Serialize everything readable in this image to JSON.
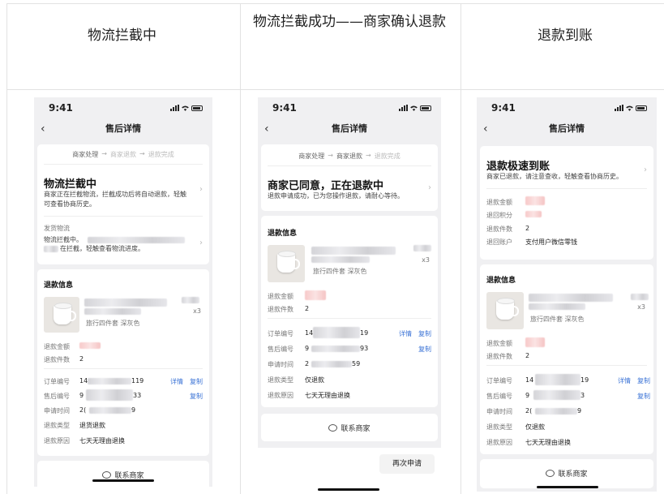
{
  "columns": [
    {
      "header": "物流拦截中"
    },
    {
      "header": "物流拦截成功——商家确认退款"
    },
    {
      "header": "退款到账"
    }
  ],
  "phone": {
    "time": "9:41",
    "title": "售后详情",
    "back_glyph": "‹",
    "chevron_glyph": "›"
  },
  "steps": {
    "s1": "商家处理",
    "s2": "商家退款",
    "s3": "退款完成",
    "arrow": "→"
  },
  "p1": {
    "status_title": "物流拦截中",
    "status_desc": "商家正在拦截物流，拦截成功后将自动退款，轻触可查看协商历史。",
    "logistics_label": "发货物流",
    "logistics_line1": "物流拦截中。",
    "logistics_line2": "在拦截，轻触查看物流进度。",
    "info_title": "退款信息",
    "spec": "旅行四件套 深灰色",
    "qty": "x3",
    "rows": {
      "amount": "退款金额",
      "count": "退款件数",
      "count_val": "2",
      "order": "订单编号",
      "order_a": "14",
      "order_b": "119",
      "after": "售后编号",
      "after_a": "9",
      "after_b": "33",
      "apply": "申请时间",
      "apply_a": "2(",
      "apply_b": "9",
      "type": "退款类型",
      "type_val": "退货退款",
      "reason": "退款原因",
      "reason_val": "七天无理由退换",
      "detail": "详情",
      "copy": "复制"
    },
    "contact": "联系商家"
  },
  "p2": {
    "status_title": "商家已同意，正在退款中",
    "status_desc": "退款申请成功，已为您操作退款，请耐心等待。",
    "info_title": "退款信息",
    "spec": "旅行四件套 深灰色",
    "qty": "x3",
    "rows": {
      "amount": "退款金额",
      "count": "退款件数",
      "count_val": "2",
      "order": "订单编号",
      "order_a": "14",
      "order_b": "19",
      "after": "售后编号",
      "after_a": "9",
      "after_b": "93",
      "apply": "申请时间",
      "apply_a": "2",
      "apply_b": "59",
      "type": "退款类型",
      "type_val": "仅退款",
      "reason": "退款原因",
      "reason_val": "七天无理由退换",
      "detail": "详情",
      "copy": "复制"
    },
    "contact": "联系商家",
    "reapply": "再次申请"
  },
  "p3": {
    "status_title": "退款极速到账",
    "status_desc": "商家已退款，请注意查收，轻触查看协商历史。",
    "top_rows": {
      "amount": "退款金额",
      "points": "退回积分",
      "count": "退款件数",
      "count_val": "2",
      "account": "退回账户",
      "account_val": "支付用户微信零钱"
    },
    "info_title": "退款信息",
    "spec": "旅行四件套 深灰色",
    "qty": "x3",
    "rows": {
      "amount": "退款金额",
      "count": "退款件数",
      "count_val": "2",
      "order": "订单编号",
      "order_a": "14",
      "order_b": "19",
      "after": "售后编号",
      "after_a": "9",
      "after_b": "3",
      "apply": "申请时间",
      "apply_a": "2(",
      "apply_b": "9",
      "type": "退款类型",
      "type_val": "仅退款",
      "reason": "退款原因",
      "reason_val": "七天无理由退换",
      "detail": "详情",
      "copy": "复制"
    },
    "contact": "联系商家"
  },
  "colors": {
    "link": "#3b73d6",
    "phone_bg": "#f0f0f2",
    "card_bg": "#ffffff",
    "grid_line": "#e2e2e2"
  },
  "icons": [
    "back-icon",
    "chevron-right-icon",
    "signal-icon",
    "wifi-icon",
    "battery-icon",
    "chat-icon",
    "home-indicator"
  ]
}
